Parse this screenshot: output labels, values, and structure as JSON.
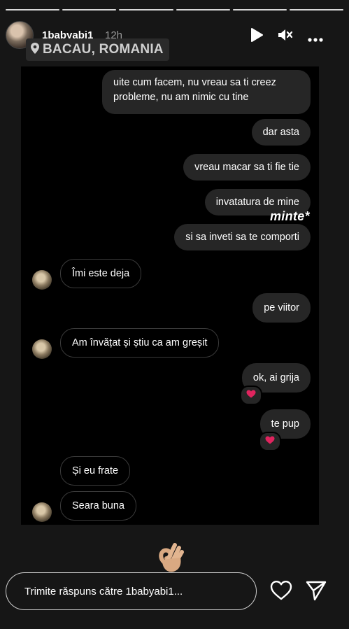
{
  "story": {
    "segments_total": 6,
    "segments_viewed": 6,
    "username": "1babyabi1",
    "time": "12h",
    "location": "BACAU, ROMANIA"
  },
  "chat": {
    "messages": [
      {
        "dir": "out",
        "lines": [
          "uite cum facem, nu vreau sa ti creez",
          "probleme, nu am nimic cu tine"
        ]
      },
      {
        "dir": "out",
        "text": "dar asta"
      },
      {
        "dir": "out",
        "text": "vreau macar sa ti fie tie"
      },
      {
        "dir": "out",
        "text": "invatatura de mine"
      },
      {
        "dir": "sticker",
        "text": "minte*"
      },
      {
        "dir": "out",
        "text": "si sa inveti sa te comporti"
      },
      {
        "dir": "in",
        "text": "Îmi este deja"
      },
      {
        "dir": "out",
        "text": "pe viitor"
      },
      {
        "dir": "in",
        "text": "Am învățat și știu ca am greșit"
      },
      {
        "dir": "out",
        "text": "ok, ai grija",
        "reaction": "heart"
      },
      {
        "dir": "out",
        "text": "te pup",
        "reaction": "heart"
      },
      {
        "dir": "in",
        "text": "Și eu frate"
      },
      {
        "dir": "in",
        "text": "Seara buna"
      }
    ]
  },
  "reply_bar": {
    "placeholder": "Trimite răspuns către 1babyabi1..."
  },
  "icons": {
    "play": "play-icon",
    "mute": "muted-speaker-icon",
    "more": "more-horizontal-icon",
    "location": "location-pin-icon",
    "heart": "heart-icon",
    "send": "send-icon",
    "sticker_emoji": "ok-hand-emoji"
  },
  "colors": {
    "background": "#161616",
    "chat_background": "#000000",
    "outgoing_bubble": "#262626",
    "incoming_border": "#3a3a3a",
    "reaction_heart": "#e0245e"
  }
}
